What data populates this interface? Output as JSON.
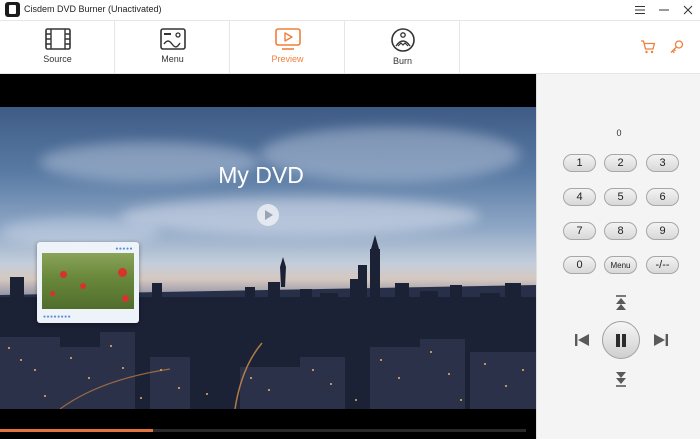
{
  "window": {
    "title": "Cisdem DVD Burner (Unactivated)"
  },
  "toolbar": {
    "tabs": [
      {
        "label": "Source",
        "icon": "film-icon"
      },
      {
        "label": "Menu",
        "icon": "menu-layout-icon"
      },
      {
        "label": "Preview",
        "icon": "preview-play-icon",
        "active": true
      },
      {
        "label": "Burn",
        "icon": "disc-burn-icon"
      }
    ],
    "cart_icon": "cart-icon",
    "key_icon": "key-icon"
  },
  "preview": {
    "menu_title": "My DVD",
    "playback_progress": 0.29
  },
  "remote": {
    "readout": "0",
    "keys": [
      "1",
      "2",
      "3",
      "4",
      "5",
      "6",
      "7",
      "8",
      "9",
      "0",
      "Menu",
      "-/--"
    ]
  },
  "colors": {
    "accent": "#f07f3c",
    "progress": "#e2733f"
  }
}
